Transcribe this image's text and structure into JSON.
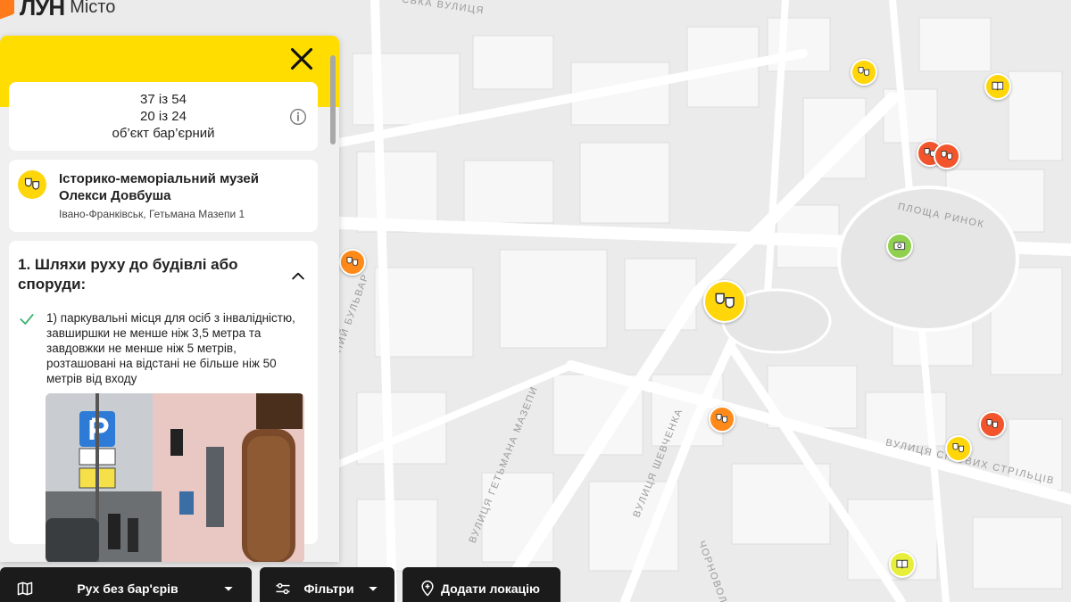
{
  "app": {
    "logo_word": "ЛУН",
    "logo_sub": "Місто"
  },
  "map": {
    "street_labels": [
      "ська вулиця",
      "площа Ринок",
      "ний бульвар",
      "вулиця Гетьмана Мазепи",
      "вулиця Шевченка",
      "вулиця Січових Стрільців",
      "Чорновола"
    ],
    "pois": [
      {
        "category": "theatre-icon",
        "color": "#ffd60a"
      },
      {
        "category": "book-icon",
        "color": "#ffd60a"
      },
      {
        "category": "theatre-icon",
        "color": "#f2552c"
      },
      {
        "category": "theatre-icon",
        "color": "#f2552c"
      },
      {
        "category": "money-icon",
        "color": "#8fd14f"
      },
      {
        "category": "theatre-icon",
        "color": "#ff8a1a"
      },
      {
        "category": "theatre-icon",
        "color": "#ffd60a"
      },
      {
        "category": "theatre-icon",
        "color": "#ff8a1a"
      },
      {
        "category": "theatre-icon",
        "color": "#f2552c"
      },
      {
        "category": "theatre-icon",
        "color": "#ffd60a"
      },
      {
        "category": "book-icon",
        "color": "#e8ef3a"
      }
    ]
  },
  "panel": {
    "rating": {
      "line1": "37 із 54",
      "line2": "20 із 24",
      "line3": "об’єкт бар’єрний"
    },
    "object": {
      "title": "Історико-меморіальний музей Олекси Довбуша",
      "address": "Івано-Франківськ, Гетьмана Мазепи 1"
    },
    "section": {
      "title": "1. Шляхи руху до будівлі або споруди:",
      "requirement": "1) паркувальні місця для осіб з інвалідністю, завширшки не менше ніж 3,5 метра та завдовжки не менше ніж 5 метрів, розташовані на відстані не більше ніж 50 метрів від входу",
      "requirement_status": "met"
    }
  },
  "bottom": {
    "route_label": "Рух без бар'єрів",
    "filter_label": "Фільтри",
    "add_label": "Додати локацію"
  },
  "colors": {
    "accent": "#ffdd00",
    "dark": "#1b1b1b",
    "check": "#3cb371"
  }
}
